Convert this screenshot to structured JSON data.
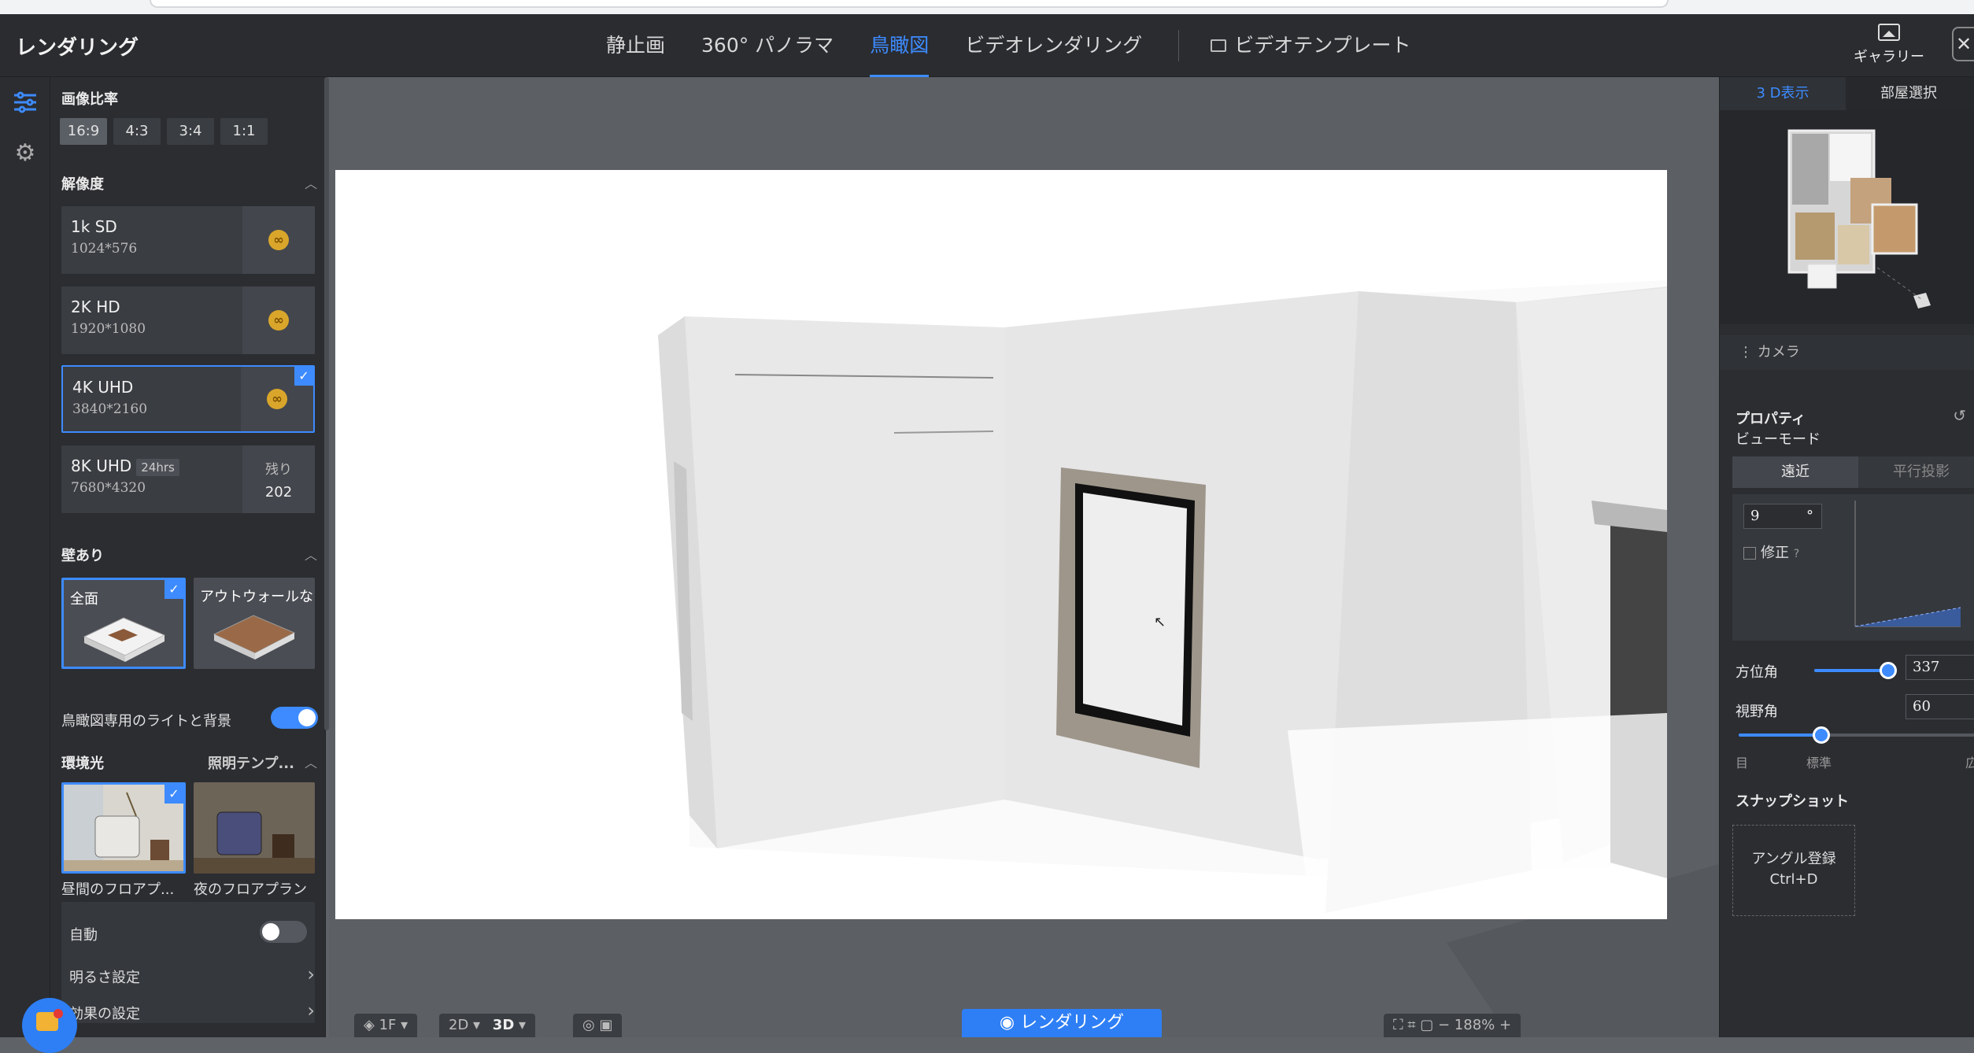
{
  "app": {
    "title": "レンダリング"
  },
  "nav": {
    "tabs": [
      {
        "label": "静止画"
      },
      {
        "label": "360° パノラマ"
      },
      {
        "label": "鳥瞰図"
      },
      {
        "label": "ビデオレンダリング"
      }
    ],
    "active_tab": "鳥瞰図",
    "template_label": "ビデオテンプレート",
    "gallery_label": "ギャラリー",
    "close_label": "✕"
  },
  "left": {
    "aspect_title": "画像比率",
    "aspect_options": [
      "16:9",
      "4:3",
      "3:4",
      "1:1"
    ],
    "aspect_selected": "16:9",
    "resolution_title": "解像度",
    "resolutions": [
      {
        "name": "1k SD",
        "size": "1024*576"
      },
      {
        "name": "2K HD",
        "size": "1920*1080"
      },
      {
        "name": "4K UHD",
        "size": "3840*2160"
      },
      {
        "name": "8K UHD",
        "size": "7680*4320",
        "badge": "24hrs",
        "remain_label": "残り",
        "remain_value": "202"
      }
    ],
    "resolution_selected": "4K UHD",
    "walls_title": "壁あり",
    "walls_options": [
      "全面",
      "アウトウォールな"
    ],
    "walls_selected": "全面",
    "birdseye_light_label": "鳥瞰図専用のライトと背景",
    "birdseye_light_on": true,
    "env_title": "環境光",
    "env_template_label": "照明テンプ...",
    "env_options": [
      "昼間のフロアプ...",
      "夜のフロアプラン"
    ],
    "env_selected": "昼間のフロアプ...",
    "auto_label": "自動",
    "auto_on": false,
    "brightness_label": "明るさ設定",
    "effects_label": "効果の設定"
  },
  "right": {
    "tabs": [
      "3 D表示",
      "部屋選択"
    ],
    "active_tab": "3 D表示",
    "camera_title": "カメラ",
    "properties_title": "プロパティ",
    "view_mode_label": "ビューモード",
    "view_modes": [
      "遠近",
      "平行投影"
    ],
    "view_mode_selected": "遠近",
    "tilt_value": "9",
    "tilt_unit": "°",
    "correct_label": "修正",
    "azimuth_label": "方位角",
    "azimuth_value": "337",
    "azimuth_fraction": 0.94,
    "fov_label": "視野角",
    "fov_value": "60",
    "fov_fraction": 0.35,
    "fov_marks": [
      "目",
      "標準",
      "広"
    ],
    "snapshot_title": "スナップショット",
    "snapshot_button": "アングル登録",
    "snapshot_shortcut": "Ctrl+D"
  },
  "bottom": {
    "render_label": "レンダリング",
    "floor_label": "1F",
    "view2d_label": "2D",
    "view3d_label": "3D",
    "zoom_value": "188",
    "zoom_unit": "%"
  },
  "colors": {
    "accent": "#3d8bff",
    "panel": "#2b2d31",
    "viewport": "#5c5f64",
    "coin": "#d9a62b"
  }
}
